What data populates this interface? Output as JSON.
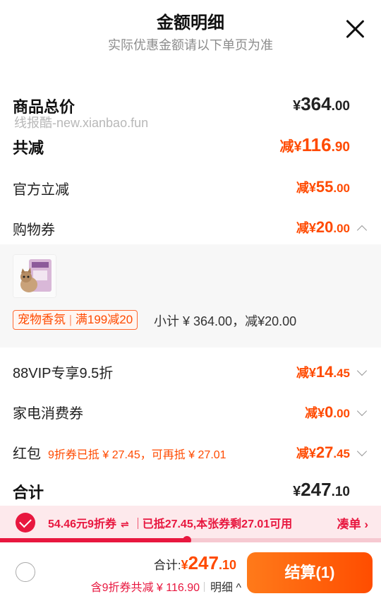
{
  "header": {
    "title": "金额明细",
    "subtitle": "实际优惠金额请以下单页为准"
  },
  "watermark": "线报酷-new.xianbao.fun",
  "summary": {
    "total_label": "商品总价",
    "total_yen": "¥",
    "total_int": "364",
    "total_dec": ".00",
    "reduce_label": "共减",
    "reduce_prefix": "减¥",
    "reduce_int": "116",
    "reduce_dec": ".90"
  },
  "items": [
    {
      "label": "官方立减",
      "prefix": "减¥",
      "int": "55",
      "dec": ".00"
    },
    {
      "label": "购物券",
      "prefix": "减¥",
      "int": "20",
      "dec": ".00"
    },
    {
      "label": "88VIP专享9.5折",
      "prefix": "减¥",
      "int": "14",
      "dec": ".45"
    },
    {
      "label": "家电消费券",
      "prefix": "减¥",
      "int": "0",
      "dec": ".00"
    },
    {
      "label": "红包",
      "note": "9折券已抵 ¥ 27.45，可再抵 ¥ 27.01",
      "prefix": "减¥",
      "int": "27",
      "dec": ".45"
    }
  ],
  "coupon_panel": {
    "tag_name": "宠物香氛",
    "tag_rule": "满199减20",
    "subtotal": "小计 ¥ 364.00，减¥20.00"
  },
  "grand_total": {
    "label": "合计",
    "yen": "¥",
    "int": "247",
    "dec": ".10"
  },
  "promo": {
    "coupon": "54.46元9折券",
    "swap_icon": "⇌",
    "status": "已抵27.45,本张券剩27.01可用",
    "addon": "凑单 ›",
    "progress": 0.49,
    "color": "#e8173f"
  },
  "footer": {
    "total_label": "合计:",
    "yen": "¥",
    "int": "247",
    "dec": ".10",
    "discount": "含9折券共减 ¥ 116.90",
    "detail": "明细 ^",
    "checkout": "结算(1)",
    "accent": "#ff4a00"
  }
}
